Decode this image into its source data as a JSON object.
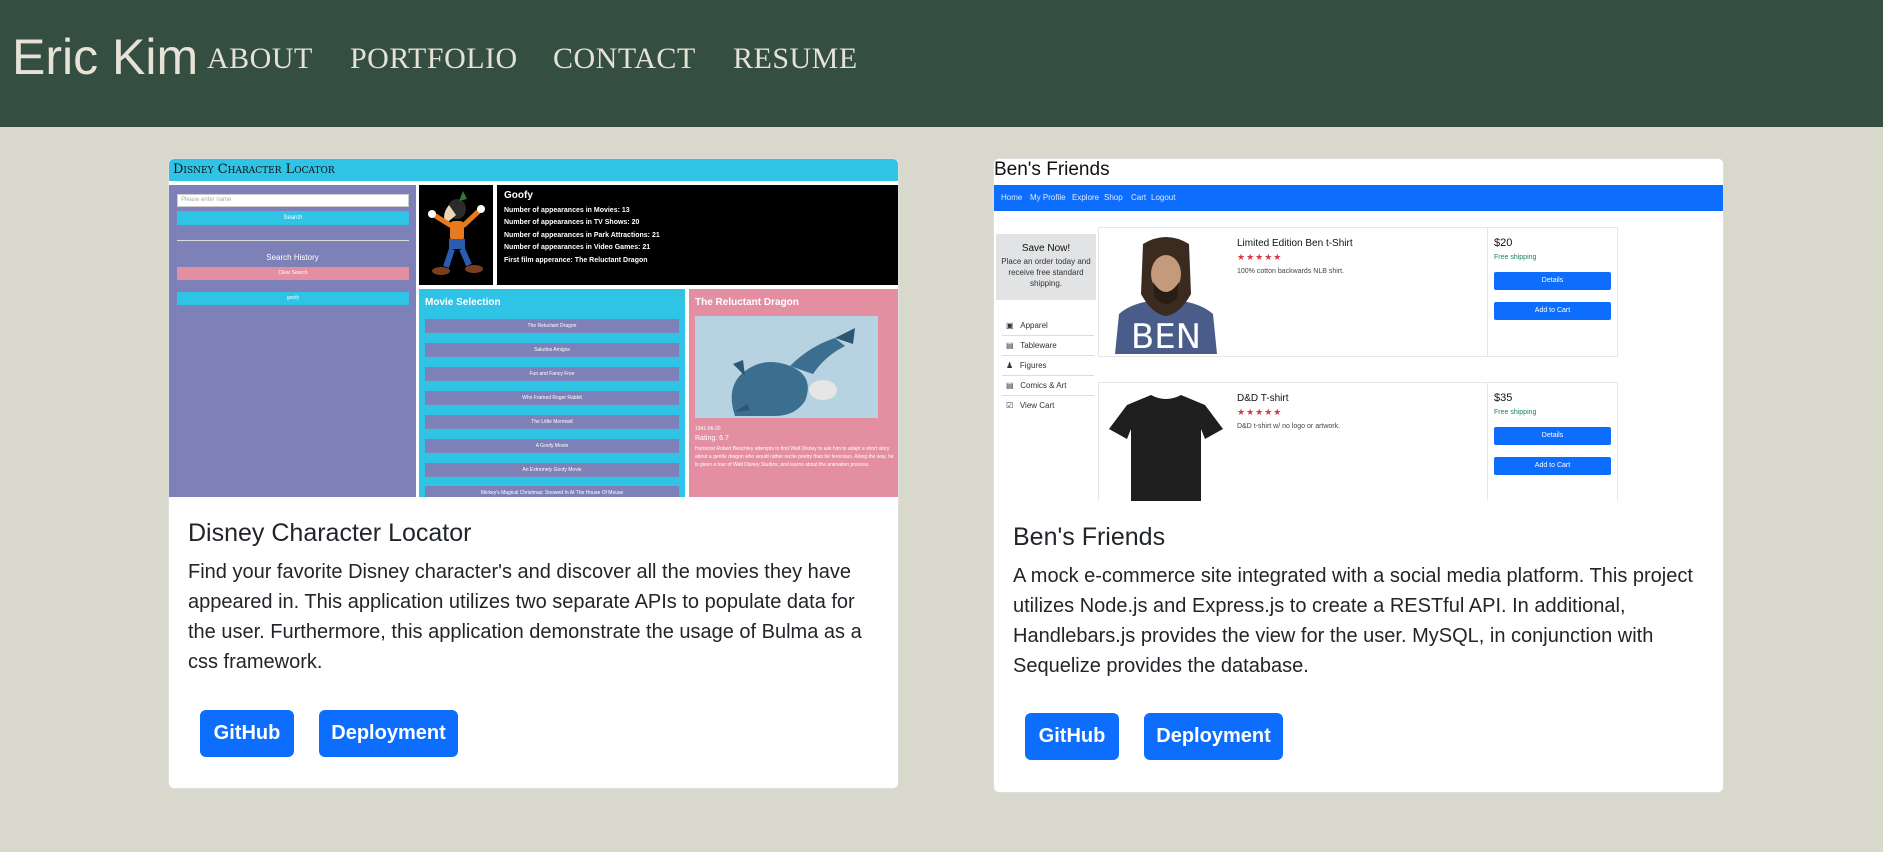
{
  "nav": {
    "brand": "Eric Kim",
    "links": [
      "ABOUT",
      "PORTFOLIO",
      "CONTACT",
      "RESUME"
    ]
  },
  "projects": [
    {
      "title": "Disney Character Locator",
      "description": "Find your favorite Disney character's and discover all the movies they have appeared in. This application utilizes two separate APIs to populate data for the user. Furthermore, this application demonstrate the usage of Bulma as a css framework.",
      "buttons": [
        "GitHub",
        "Deployment"
      ],
      "preview": {
        "app_title": "Disney Character Locator",
        "search_placeholder": "Please enter name",
        "search_button": "Search",
        "search_history": "Search History",
        "clear_button": "Clear Search",
        "history_item": "goofy",
        "character": "Goofy",
        "stats": [
          "Number of appearances in Movies: 13",
          "Number of appearances in TV Shows: 20",
          "Number of appearances in Park Attractions: 21",
          "Number of appearances in Video Games: 21",
          "First film apperance: The Reluctant Dragon"
        ],
        "movies_title": "Movie Selection",
        "movies": [
          "The Reluctant Dragon",
          "Saludos Amigos",
          "Fun and Fancy Free",
          "Who Framed Roger Rabbit",
          "The Little Mermaid",
          "A Goofy Movie",
          "An Extremely Goofy Movie",
          "Mickey's Magical Christmas: Snowed In At The House Of Mouse"
        ],
        "detail_title": "The Reluctant Dragon",
        "detail_date": "1941-06-20",
        "detail_rating": "Rating: 6.7",
        "detail_text": "Humorist Robert Benchley attempts to find Walt Disney to ask him to adapt a short story about a gentle dragon who would rather recite poetry than be ferocious. Along the way, he is given a tour of Walt Disney Studios, and learns about the animation process."
      }
    },
    {
      "title": "Ben's Friends",
      "description": "A mock e-commerce site integrated with a social media platform. This project utilizes Node.js and Express.js to create a RESTful API. In additional, Handlebars.js provides the view for the user. MySQL, in conjunction with Sequelize provides the database.",
      "buttons": [
        "GitHub",
        "Deployment"
      ],
      "preview": {
        "site_title": "Ben's Friends",
        "nav": [
          "Home",
          "My Profile",
          "Explore",
          "Shop",
          "Cart",
          "Logout"
        ],
        "promo_title": "Save Now!",
        "promo_text": "Place an order today and receive free standard shipping.",
        "categories": [
          "Apparel",
          "Tableware",
          "Figures",
          "Comics & Art",
          "View Cart"
        ],
        "products": [
          {
            "name": "Limited Edition Ben t-Shirt",
            "stars": "★★★★★",
            "desc": "100% cotton backwards NLB shirt.",
            "price": "$20",
            "shipping": "Free shipping",
            "details": "Details",
            "add": "Add to Cart",
            "shirt_text": "BEN"
          },
          {
            "name": "D&D T-shirt",
            "stars": "★★★★★",
            "desc": "D&D t-shirt w/ no logo or artwork.",
            "price": "$35",
            "shipping": "Free shipping",
            "details": "Details",
            "add": "Add to Cart"
          }
        ]
      }
    }
  ],
  "colors": {
    "navbar": "#344e41",
    "background": "#d9d8cc",
    "button": "#0d6efd",
    "disney_cyan": "#2fc3e5",
    "disney_purple": "#7e80b8",
    "disney_pink": "#e38fa1"
  }
}
